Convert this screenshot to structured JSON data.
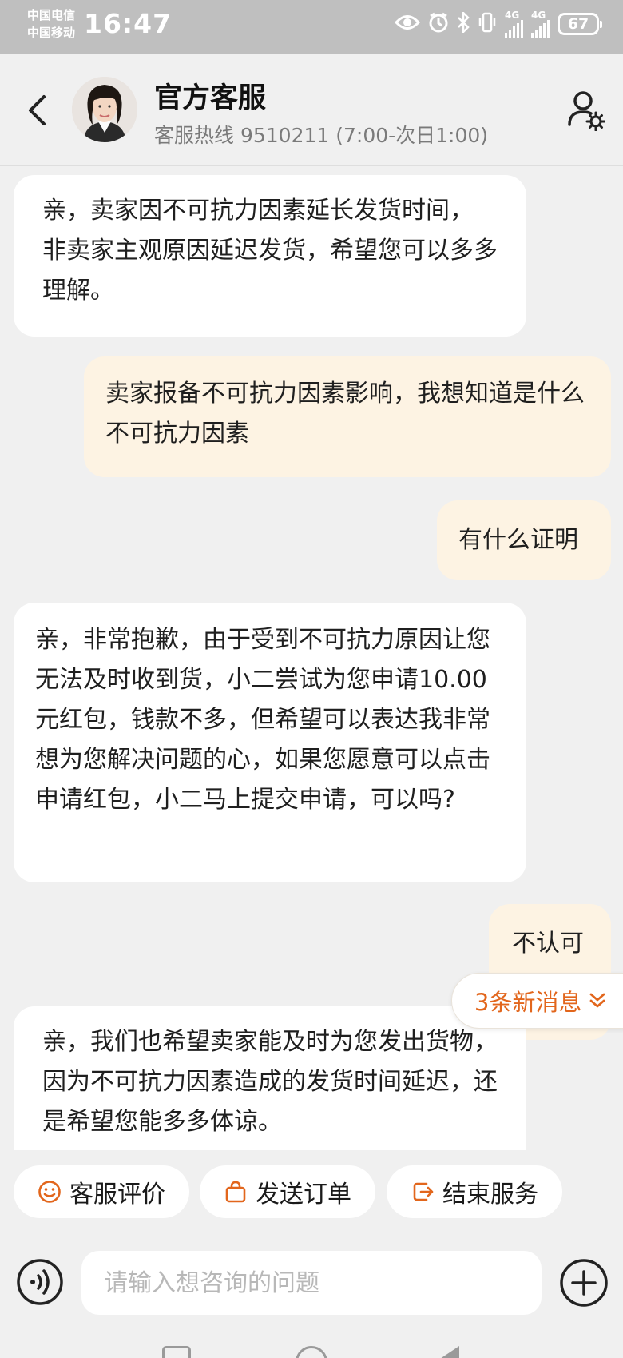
{
  "status_bar": {
    "carrier_1": "中国电信",
    "carrier_2": "中国移动",
    "time": "16:47",
    "net_1": "4G",
    "net_2": "4G",
    "battery": "67",
    "icons": [
      "eye-icon",
      "alarm-icon",
      "bluetooth-icon",
      "vibrate-icon",
      "signal-icon",
      "battery-icon"
    ]
  },
  "header": {
    "back_icon": "chevron-left-icon",
    "title": "官方客服",
    "hotline": "客服热线 9510211 (7:00-次日1:00)",
    "profile_icon": "user-settings-icon"
  },
  "messages": [
    {
      "side": "in",
      "text": "亲，卖家因不可抗力因素延长发货时间， 非卖家主观原因延迟发货，希望您可以多多理解。"
    },
    {
      "side": "out",
      "text": "卖家报备不可抗力因素影响，我想知道是什么不可抗力因素"
    },
    {
      "side": "out",
      "text": "有什么证明"
    },
    {
      "side": "in",
      "text": "亲，非常抱歉，由于受到不可抗力原因让您无法及时收到货，小二尝试为您申请10.00元红包，钱款不多，但希望可以表达我非常想为您解决问题的心，如果您愿意可以点击申请红包，小二马上提交申请，可以吗?"
    },
    {
      "side": "out",
      "text": "不认可"
    },
    {
      "side": "in",
      "text": "亲，我们也希望卖家能及时为您发出货物，因为不可抗力因素造成的发货时间延迟，还是希望您能多多体谅。"
    }
  ],
  "new_messages": {
    "label": "3条新消息",
    "icon": "double-chevron-down-icon"
  },
  "actions": [
    {
      "label": "客服评价",
      "icon": "smile-icon"
    },
    {
      "label": "发送订单",
      "icon": "shopping-bag-icon"
    },
    {
      "label": "结束服务",
      "icon": "exit-icon"
    }
  ],
  "input": {
    "placeholder": "请输入想咨询的问题",
    "value": "",
    "voice_icon": "voice-icon",
    "plus_icon": "plus-icon"
  },
  "colors": {
    "background": "#f0f0f0",
    "incoming_bubble": "#ffffff",
    "outgoing_bubble": "#fdf3e3",
    "accent": "#e2661c",
    "status_bar": "#bfbfbf"
  }
}
